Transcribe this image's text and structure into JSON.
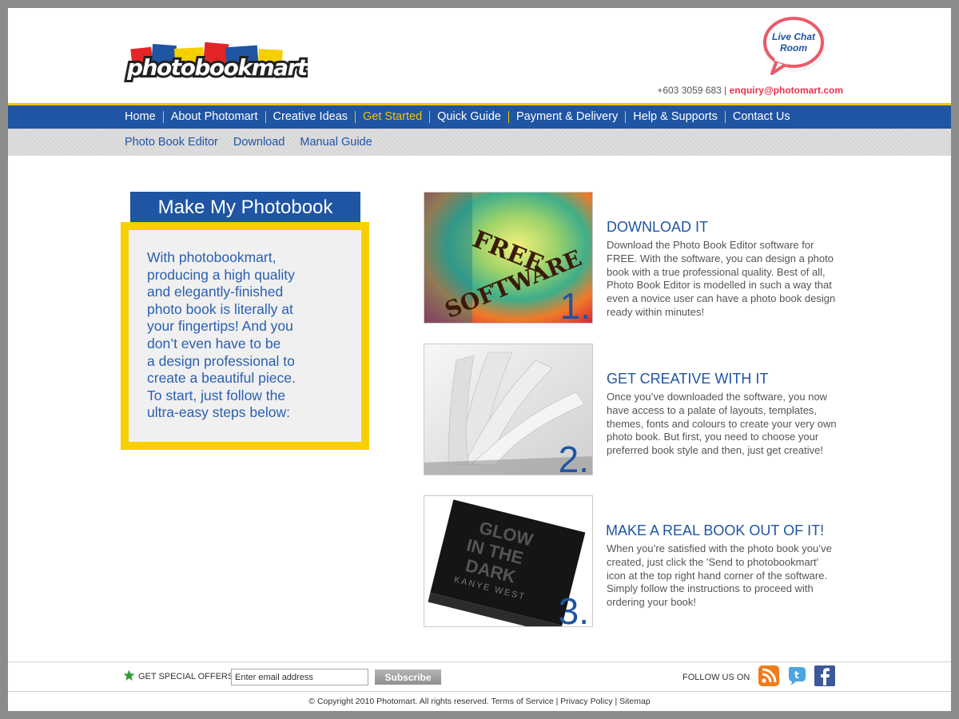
{
  "header": {
    "logo_text": "photobookmart",
    "chat_line1": "Live Chat",
    "chat_line2": "Room",
    "phone": "+603 3059 683",
    "separator": "|",
    "email": "enquiry@photomart.com"
  },
  "nav": {
    "items": [
      {
        "label": "Home"
      },
      {
        "label": "About Photomart"
      },
      {
        "label": "Creative Ideas"
      },
      {
        "label": "Get Started",
        "active": true
      },
      {
        "label": "Quick Guide"
      },
      {
        "label": "Payment & Delivery"
      },
      {
        "label": "Help & Supports"
      },
      {
        "label": "Contact Us"
      }
    ]
  },
  "subnav": {
    "items": [
      {
        "label": "Photo Book Editor"
      },
      {
        "label": "Download"
      },
      {
        "label": "Manual Guide"
      }
    ]
  },
  "intro": {
    "title": "Make My Photobook",
    "lines": [
      "With photobookmart,",
      "producing a high quality",
      "and elegantly-finished",
      "photo book is literally at",
      "your fingertips! And you",
      "don’t even have to be",
      "a design professional to",
      "create a beautiful piece.",
      "To start, just follow the",
      "ultra-easy steps below:"
    ]
  },
  "steps": [
    {
      "number": "1.",
      "image_text_1": "FREE",
      "image_text_2": "SOFTWARE",
      "title": "DOWNLOAD IT",
      "text": "Download the Photo Book Editor software for FREE. With the software, you can design a photo book with a true professional quality. Best of all, Photo Book Editor is modelled in such a way that even a novice user can have a photo book design ready within minutes!"
    },
    {
      "number": "2.",
      "title": "GET CREATIVE WITH IT",
      "text": "Once you’ve downloaded the software, you now have access to a palate of layouts, templates, themes, fonts and colours to create your very own photo book. But first, you need to choose your preferred book style and then, just get creative!"
    },
    {
      "number": "3.",
      "image_text_1": "GLOW",
      "image_text_2": "IN THE",
      "image_text_3": "DARK",
      "image_text_4": "KANYE WEST",
      "title": "MAKE A REAL BOOK OUT OF IT!",
      "text": "When you’re satisfied with the photo book you’ve created, just click the 'Send to photobookmart' icon at the top right hand corner of the software. Simply follow the instructions to proceed with ordering your book!"
    }
  ],
  "footer": {
    "offers_label": "GET SPECIAL OFFERS",
    "email_placeholder": "Enter email address",
    "subscribe_label": "Subscribe",
    "follow_label": "FOLLOW US ON",
    "copyright": "© Copyright 2010 Photomart. All rights reserved.",
    "links": [
      {
        "label": "Terms of Service"
      },
      {
        "label": "Privacy Policy"
      },
      {
        "label": "Sitemap"
      }
    ],
    "link_separator": "|"
  },
  "colors": {
    "nav_blue": "#1f55a2",
    "accent_yellow": "#f4c300",
    "email_red": "#e8334a"
  },
  "icons": {
    "star": "star-icon",
    "rss": "rss-icon",
    "twitter": "twitter-icon",
    "facebook": "facebook-icon",
    "chat": "chat-bubble-icon"
  }
}
